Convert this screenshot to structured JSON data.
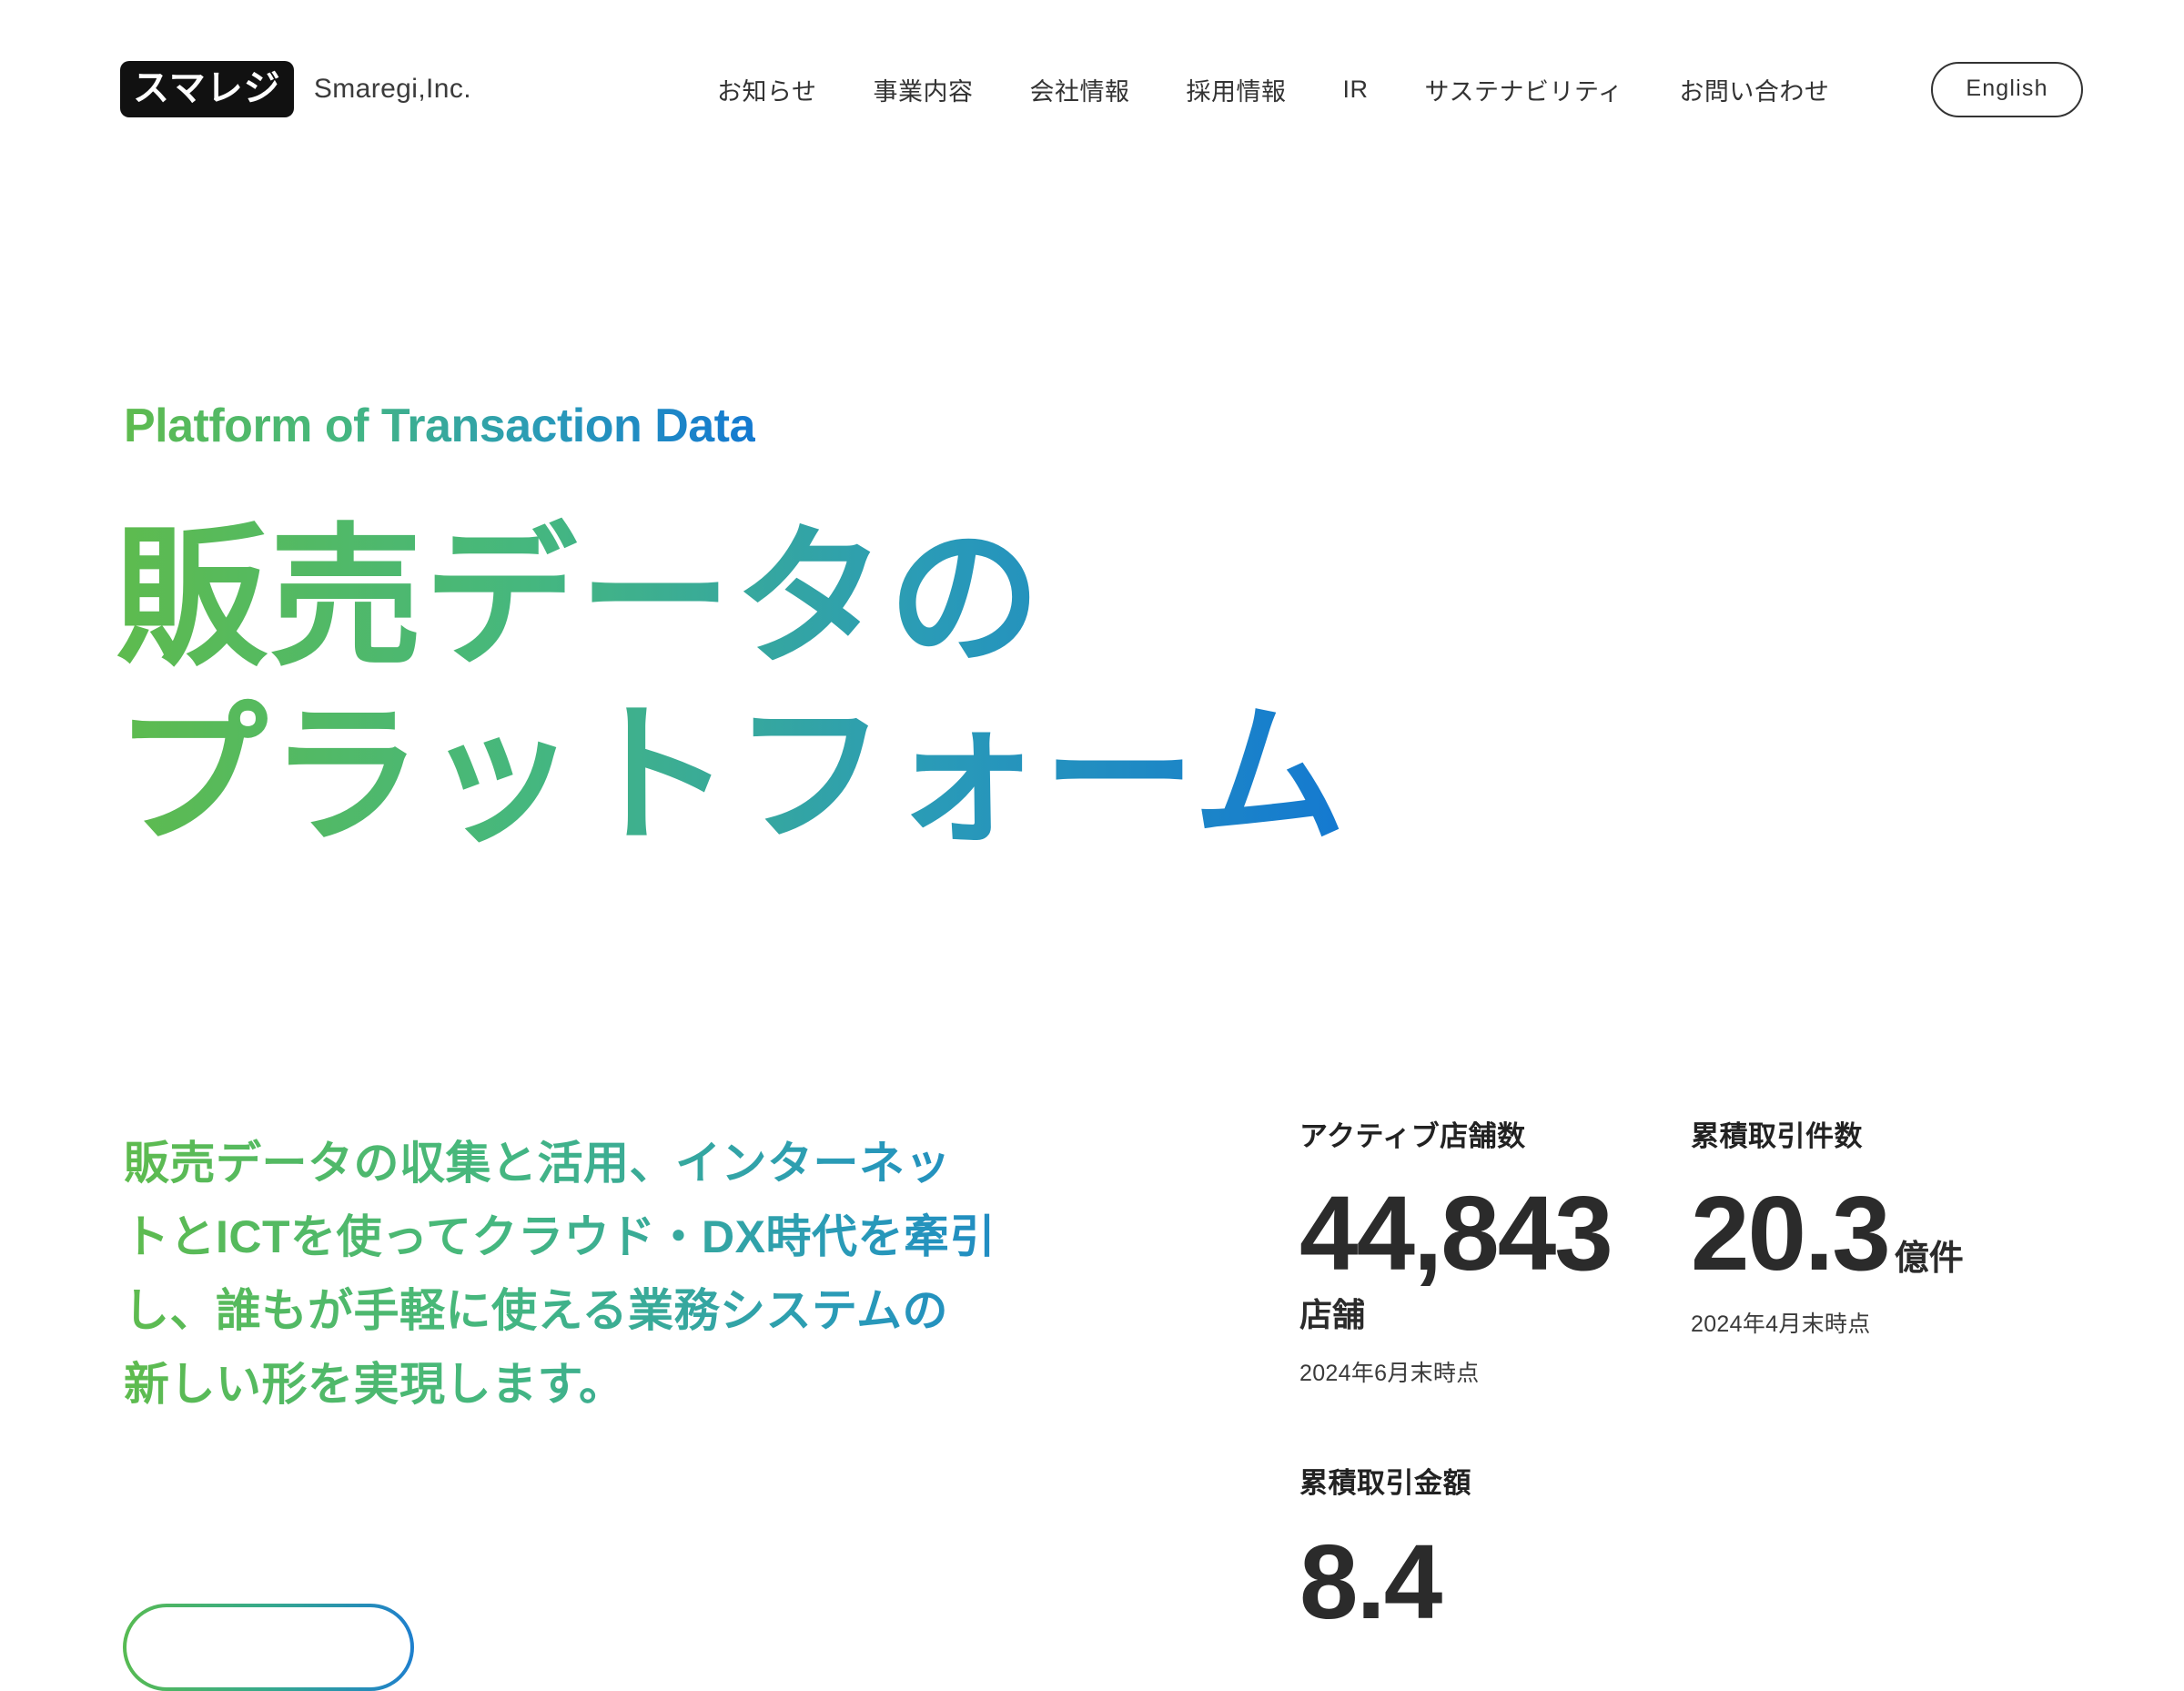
{
  "header": {
    "logo_text": "スマレジ",
    "brand_name": "Smaregi,Inc.",
    "nav": [
      {
        "label": "お知らせ"
      },
      {
        "label": "事業内容"
      },
      {
        "label": "会社情報"
      },
      {
        "label": "採用情報"
      },
      {
        "label": "IR"
      },
      {
        "label": "サステナビリティ"
      },
      {
        "label": "お問い合わせ"
      }
    ],
    "language_button": "English"
  },
  "hero": {
    "eyebrow": "Platform of Transaction Data",
    "headline_line1": "販売データの",
    "headline_line2": "プラットフォーム",
    "lede_line1": "販売データの収集と活用、インターネッ",
    "lede_line2": "トとICTを使ってクラウド・DX時代を牽引",
    "lede_line3": "し、誰もが手軽に使える業務システムの",
    "lede_line4": "新しい形を実現します。",
    "cta_label": "",
    "gradient_start": "#5ebb4e",
    "gradient_end": "#1479d1"
  },
  "stats": {
    "active_stores": {
      "label": "アクティブ店舗数",
      "value": "44,843",
      "unit": "店舗",
      "as_of": "2024年6月末時点"
    },
    "cumulative_transactions": {
      "label": "累積取引件数",
      "value": "20.3",
      "unit": "億件",
      "as_of": "2024年4月末時点"
    },
    "cumulative_amount": {
      "label": "累積取引金額",
      "value": "8.4",
      "unit": "",
      "as_of": ""
    }
  }
}
